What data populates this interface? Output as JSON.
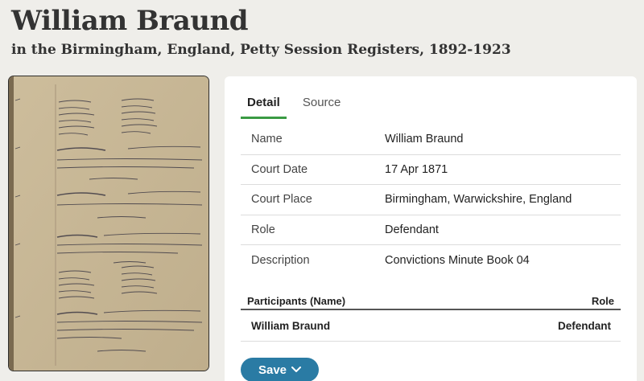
{
  "header": {
    "title": "William Braund",
    "subtitle": "in the Birmingham, England, Petty Session Registers, 1892-1923"
  },
  "tabs": [
    {
      "label": "Detail",
      "active": true
    },
    {
      "label": "Source",
      "active": false
    }
  ],
  "details": [
    {
      "label": "Name",
      "value": "William Braund"
    },
    {
      "label": "Court Date",
      "value": "17 Apr 1871"
    },
    {
      "label": "Court Place",
      "value": "Birmingham, Warwickshire, England"
    },
    {
      "label": "Role",
      "value": "Defendant"
    },
    {
      "label": "Description",
      "value": "Convictions Minute Book 04"
    }
  ],
  "participants": {
    "col_name": "Participants (Name)",
    "col_role": "Role",
    "rows": [
      {
        "name": "William Braund",
        "role": "Defendant"
      }
    ]
  },
  "save": {
    "label": "Save",
    "icon": "chevron-down-icon"
  },
  "colors": {
    "accent_green": "#3a9b43",
    "save_blue": "#2a7ba4",
    "page_bg": "#efeeea"
  }
}
